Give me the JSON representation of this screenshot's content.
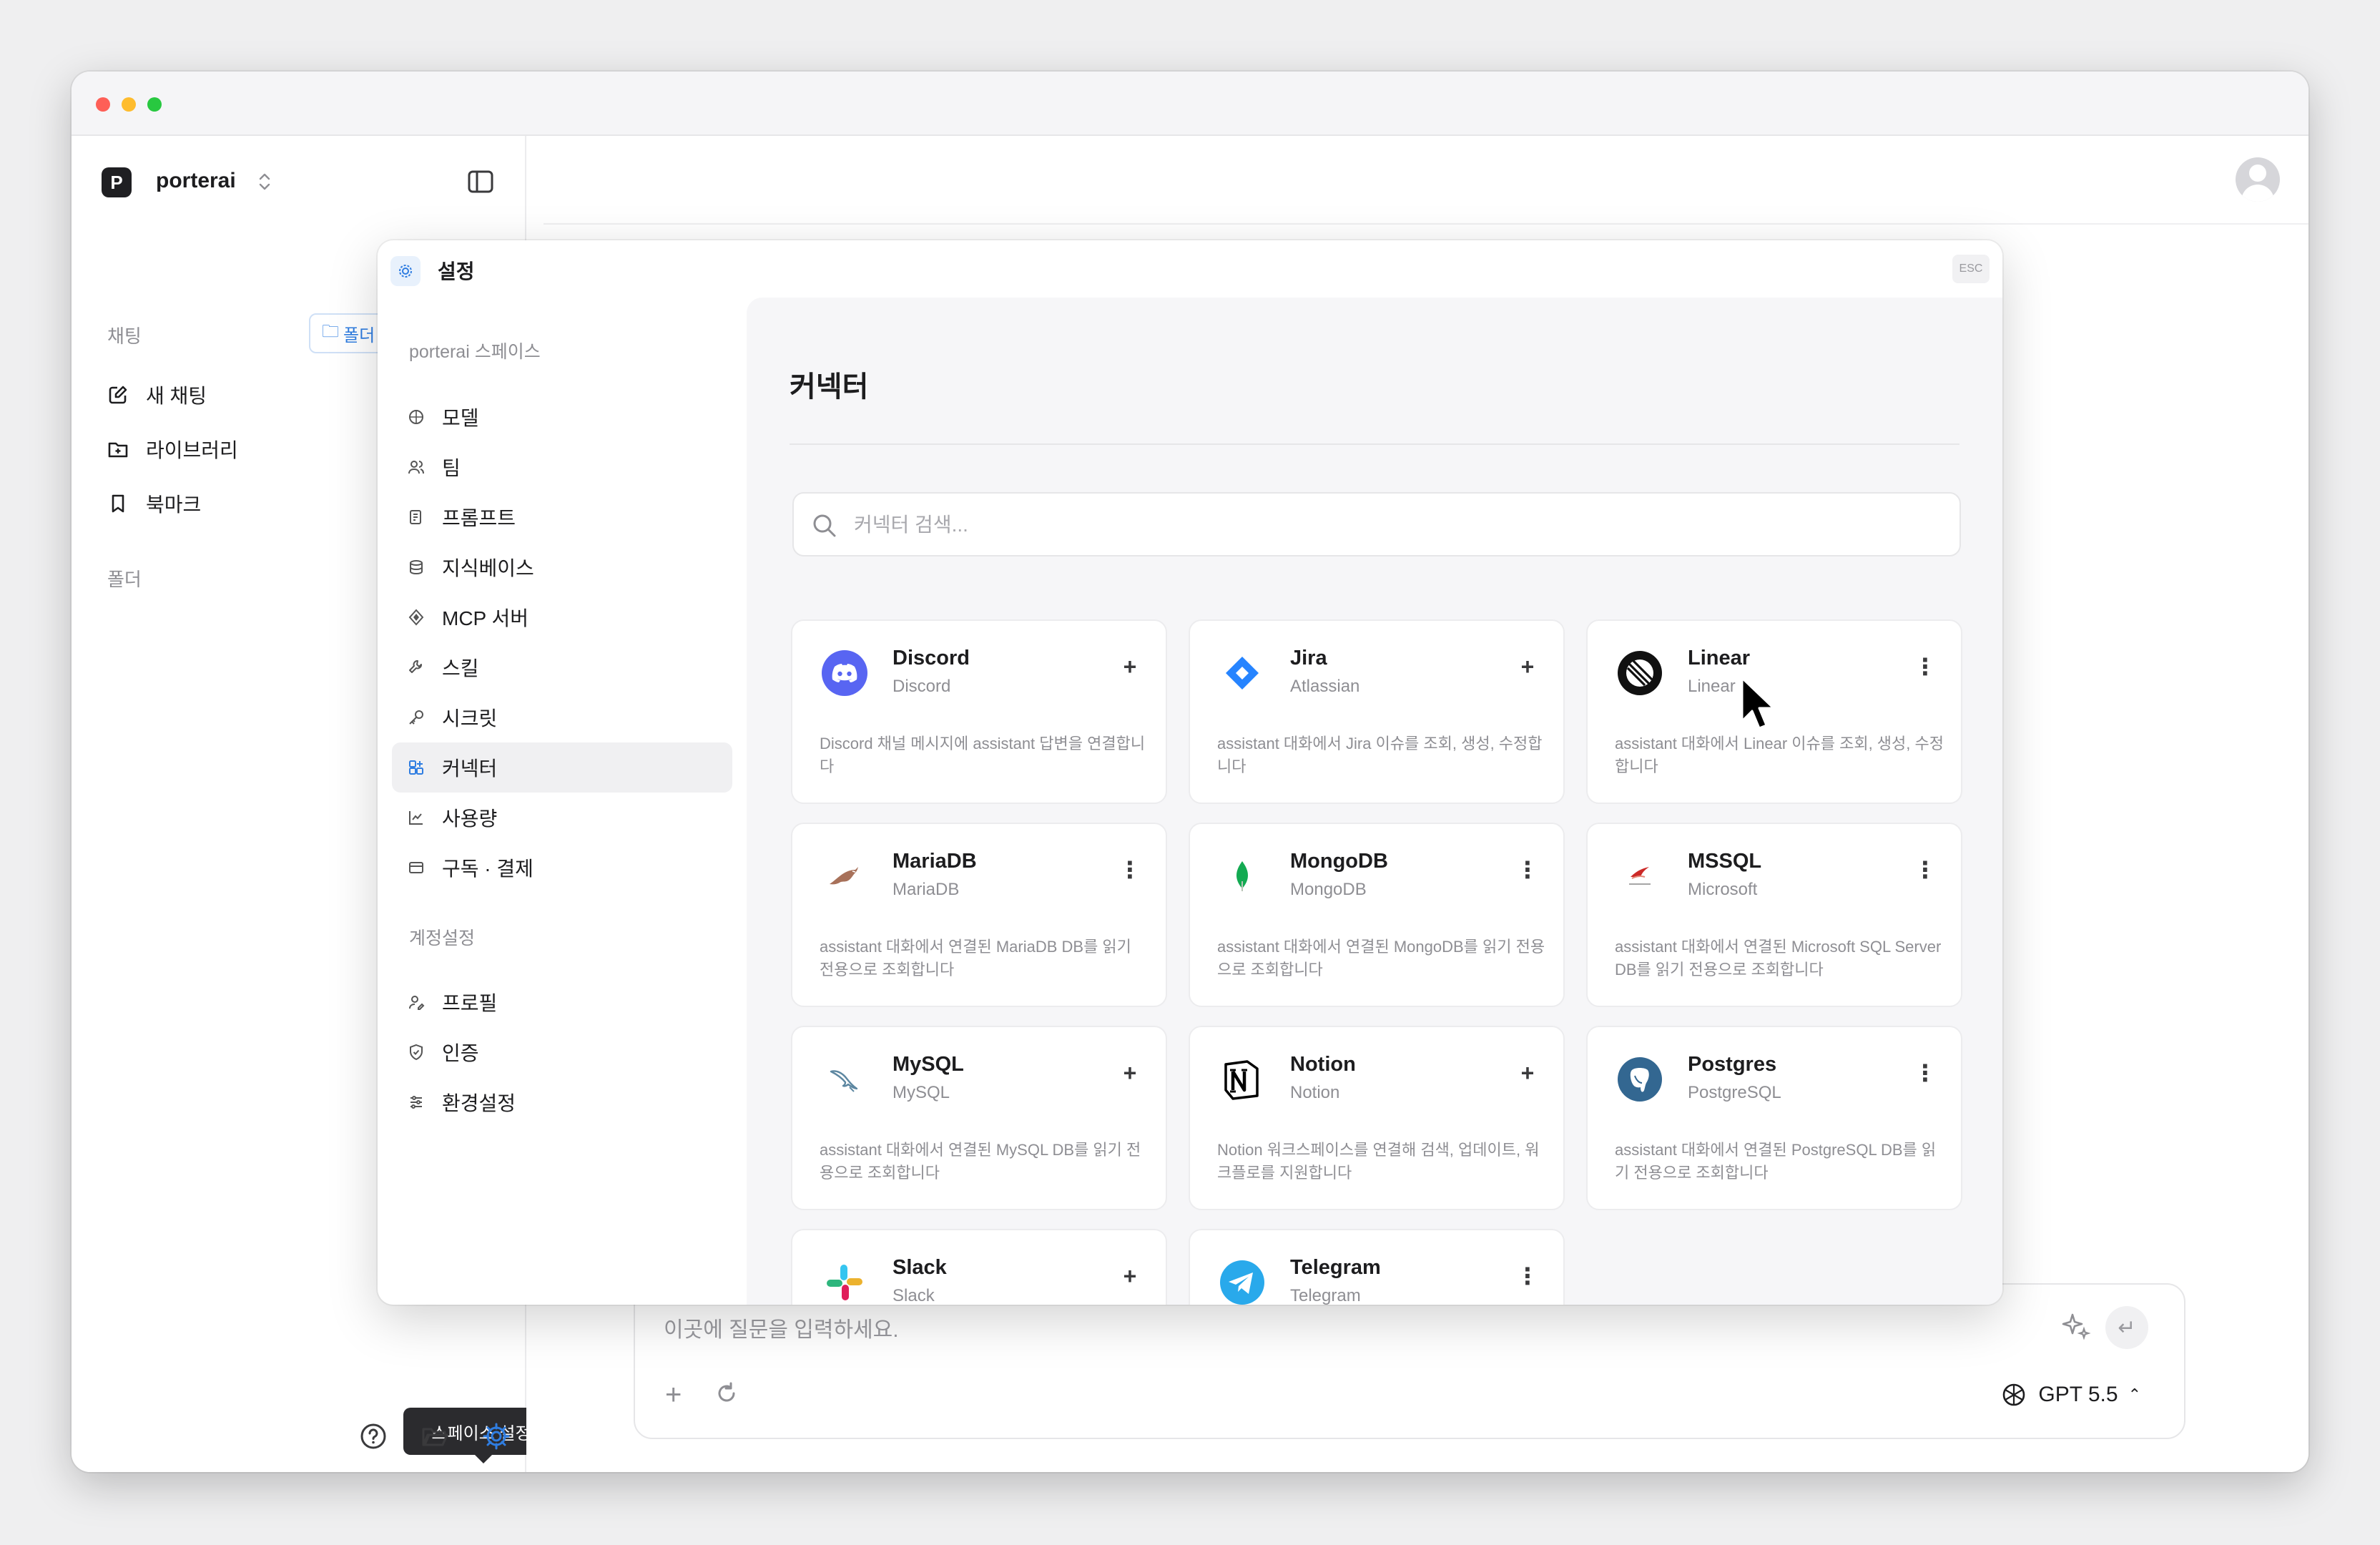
{
  "window": {
    "workspace_logo": "P",
    "workspace_name": "porterai"
  },
  "sidebar": {
    "chat_section": "채팅",
    "folder_chip": "폴더",
    "items": [
      {
        "label": "새 채팅",
        "icon": "new-chat-icon"
      },
      {
        "label": "라이브러리",
        "icon": "library-icon"
      },
      {
        "label": "북마크",
        "icon": "bookmark-icon"
      }
    ],
    "folder_section": "폴더",
    "tooltip": "스페이스 설정"
  },
  "composer": {
    "placeholder": "이곳에 질문을 입력하세요.",
    "model": "GPT 5.5"
  },
  "modal": {
    "title": "설정",
    "esc": "ESC",
    "space_group": "porterai 스페이스",
    "space_items": [
      {
        "label": "모델",
        "icon": "model-icon"
      },
      {
        "label": "팀",
        "icon": "team-icon"
      },
      {
        "label": "프롬프트",
        "icon": "prompt-icon"
      },
      {
        "label": "지식베이스",
        "icon": "database-icon"
      },
      {
        "label": "MCP 서버",
        "icon": "mcp-icon"
      },
      {
        "label": "스킬",
        "icon": "skill-icon"
      },
      {
        "label": "시크릿",
        "icon": "key-icon"
      },
      {
        "label": "커넥터",
        "icon": "connector-icon",
        "active": true
      },
      {
        "label": "사용량",
        "icon": "usage-chart-icon"
      },
      {
        "label": "구독 · 결제",
        "icon": "billing-icon"
      }
    ],
    "account_group": "계정설정",
    "account_items": [
      {
        "label": "프로필",
        "icon": "profile-icon"
      },
      {
        "label": "인증",
        "icon": "shield-icon"
      },
      {
        "label": "환경설정",
        "icon": "sliders-icon"
      }
    ],
    "content_title": "커넥터",
    "search_placeholder": "커넥터 검색..."
  },
  "connectors": [
    {
      "name": "Discord",
      "vendor": "Discord",
      "action": "+",
      "desc": "Discord 채널 메시지에 assistant 답변을 연결합니다",
      "icon": "discord-icon",
      "color": "#5865f2"
    },
    {
      "name": "Jira",
      "vendor": "Atlassian",
      "action": "+",
      "desc": "assistant 대화에서 Jira 이슈를 조회, 생성, 수정합니다",
      "icon": "jira-icon",
      "color": "#2684ff"
    },
    {
      "name": "Linear",
      "vendor": "Linear",
      "action": "⋮",
      "desc": "assistant 대화에서 Linear 이슈를 조회, 생성, 수정합니다",
      "icon": "linear-icon",
      "color": "#111111"
    },
    {
      "name": "MariaDB",
      "vendor": "MariaDB",
      "action": "⋮",
      "desc": "assistant 대화에서 연결된 MariaDB DB를 읽기 전용으로 조회합니다",
      "icon": "mariadb-icon",
      "color": "#c0765a"
    },
    {
      "name": "MongoDB",
      "vendor": "MongoDB",
      "action": "⋮",
      "desc": "assistant 대화에서 연결된 MongoDB를 읽기 전용으로 조회합니다",
      "icon": "mongodb-icon",
      "color": "#13aa52"
    },
    {
      "name": "MSSQL",
      "vendor": "Microsoft",
      "action": "⋮",
      "desc": "assistant 대화에서 연결된 Microsoft SQL Server DB를 읽기 전용으로 조회합니다",
      "icon": "mssql-icon",
      "color": "#cc2927"
    },
    {
      "name": "MySQL",
      "vendor": "MySQL",
      "action": "+",
      "desc": "assistant 대화에서 연결된 MySQL DB를 읽기 전용으로 조회합니다",
      "icon": "mysql-icon",
      "color": "#5d87a1"
    },
    {
      "name": "Notion",
      "vendor": "Notion",
      "action": "+",
      "desc": "Notion 워크스페이스를 연결해 검색, 업데이트, 워크플로를 지원합니다",
      "icon": "notion-icon",
      "color": "#000000"
    },
    {
      "name": "Postgres",
      "vendor": "PostgreSQL",
      "action": "⋮",
      "desc": "assistant 대화에서 연결된 PostgreSQL DB를 읽기 전용으로 조회합니다",
      "icon": "postgres-icon",
      "color": "#336791"
    },
    {
      "name": "Slack",
      "vendor": "Slack",
      "action": "+",
      "desc": "",
      "icon": "slack-icon",
      "color": "#4a154b"
    },
    {
      "name": "Telegram",
      "vendor": "Telegram",
      "action": "⋮",
      "desc": "",
      "icon": "telegram-icon",
      "color": "#29a9eb"
    }
  ]
}
